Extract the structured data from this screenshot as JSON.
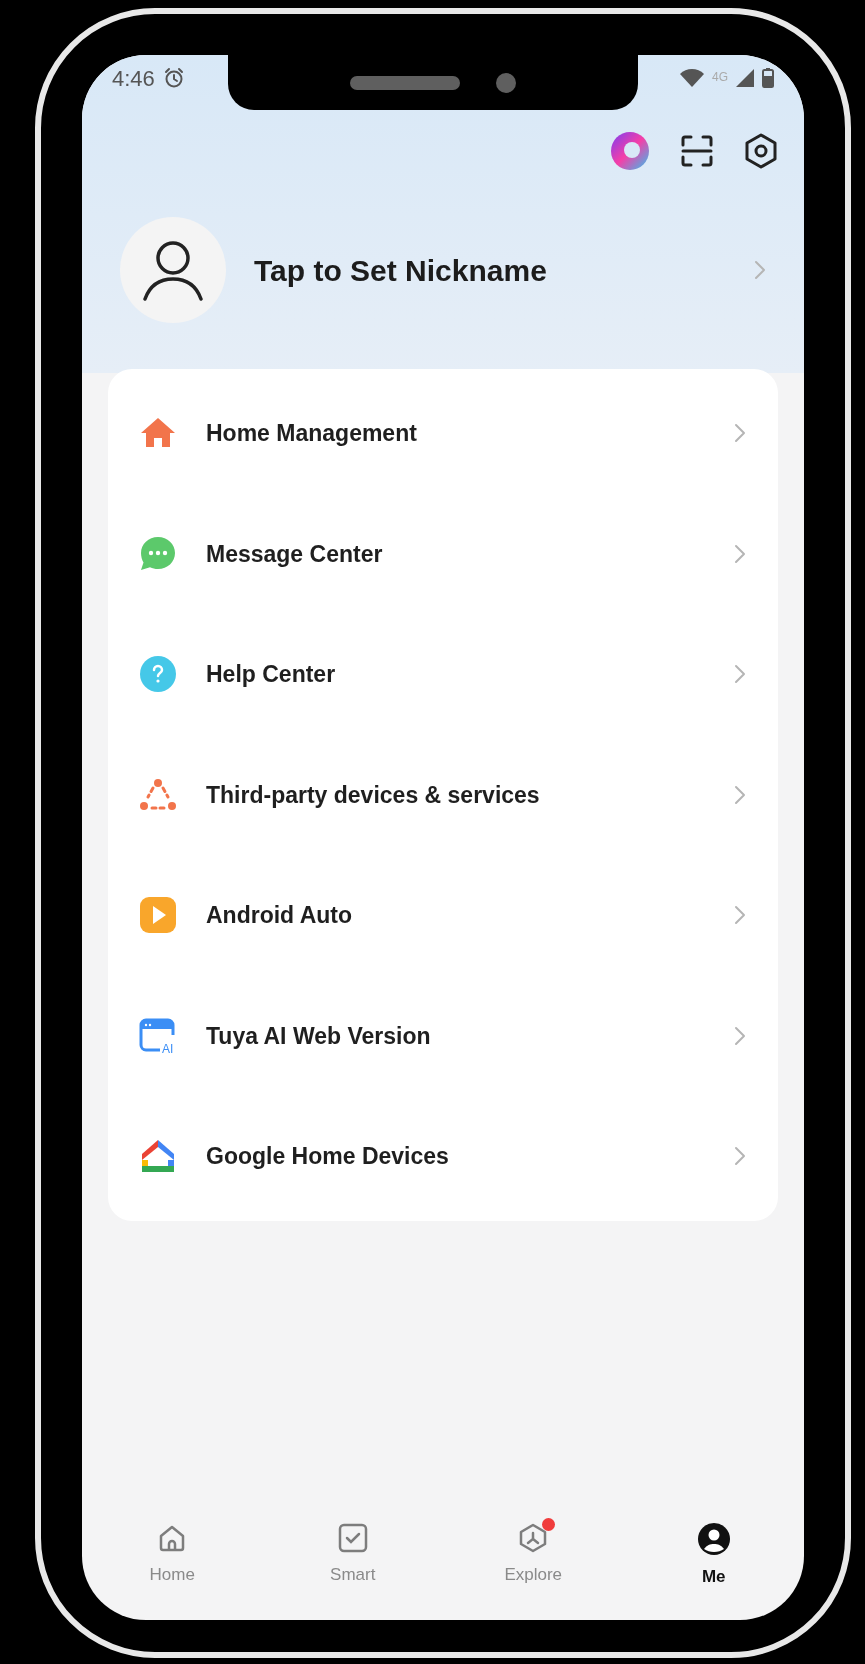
{
  "status_bar": {
    "time": "4:46",
    "network": "4G"
  },
  "profile": {
    "nickname": "Tap to Set Nickname"
  },
  "menu": [
    {
      "label": "Home Management"
    },
    {
      "label": "Message Center"
    },
    {
      "label": "Help Center"
    },
    {
      "label": "Third-party devices & services"
    },
    {
      "label": "Android Auto"
    },
    {
      "label": "Tuya AI Web Version",
      "icon_text": "AI"
    },
    {
      "label": "Google Home Devices"
    }
  ],
  "tabs": [
    {
      "label": "Home",
      "selected": false,
      "badge": false
    },
    {
      "label": "Smart",
      "selected": false,
      "badge": false
    },
    {
      "label": "Explore",
      "selected": false,
      "badge": true
    },
    {
      "label": "Me",
      "selected": true,
      "badge": false
    }
  ]
}
